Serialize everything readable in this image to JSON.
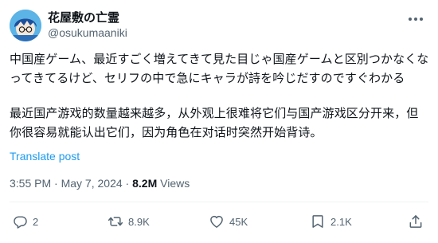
{
  "user": {
    "display_name": "花屋敷の亡霊",
    "handle": "@osukumaaniki"
  },
  "tweet": {
    "text_ja": "中国産ゲーム、最近すごく増えてきて見た目じゃ国産ゲームと区別つかなくなってきてるけど、セリフの中で急にキャラが詩を吟じだすのですぐわかる",
    "text_zh": "最近国产游戏的数量越来越多，从外观上很难将它们与国产游戏区分开来，但你很容易就能认出它们，因为角色在对话时突然开始背诗。",
    "translate_label": "Translate post",
    "time": "3:55 PM",
    "separator": "·",
    "date": "May 7, 2024",
    "views_count": "8.2M",
    "views_label": "Views"
  },
  "actions": {
    "reply_count": "2",
    "retweet_count": "8.9K",
    "like_count": "45K",
    "bookmark_count": "2.1K"
  },
  "icons": {
    "more": "more-horizontal-icon",
    "reply": "reply-bubble-icon",
    "retweet": "retweet-arrows-icon",
    "like": "heart-icon",
    "bookmark": "bookmark-icon",
    "share": "share-upload-icon"
  },
  "colors": {
    "text": "#0f1419",
    "muted": "#536471",
    "link": "#1d9bf0",
    "divider": "#eff3f4"
  }
}
